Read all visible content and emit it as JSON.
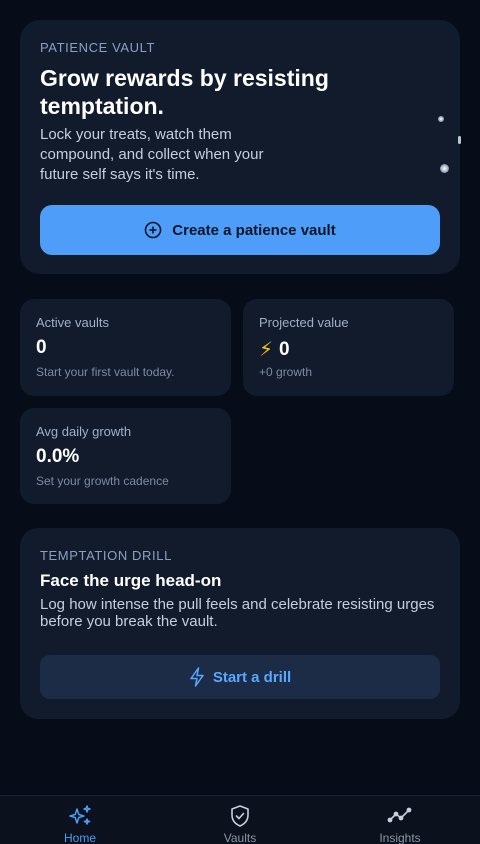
{
  "hero": {
    "eyebrow": "PATIENCE VAULT",
    "title": "Grow rewards by resisting temptation.",
    "subtitle": "Lock your treats, watch them compound, and collect when your future self says it's time.",
    "cta_label": "Create a patience vault",
    "cta_icon": "plus-circle-icon"
  },
  "stats": [
    {
      "label": "Active vaults",
      "value": "0",
      "note": "Start your first vault today."
    },
    {
      "label": "Projected value",
      "icon": "⚡",
      "value": "0",
      "note": "+0 growth"
    },
    {
      "label": "Avg daily growth",
      "value": "0.0%",
      "note": "Set your growth cadence"
    }
  ],
  "drill": {
    "eyebrow": "TEMPTATION DRILL",
    "title": "Face the urge head-on",
    "description": "Log how intense the pull feels and celebrate resisting urges before you break the vault.",
    "cta_label": "Start a drill",
    "cta_icon": "bolt-icon"
  },
  "tabs": [
    {
      "label": "Home",
      "icon": "sparkles-icon",
      "active": true
    },
    {
      "label": "Vaults",
      "icon": "shield-check-icon",
      "active": false
    },
    {
      "label": "Insights",
      "icon": "trend-line-icon",
      "active": false
    }
  ],
  "colors": {
    "background": "#060c18",
    "card": "#121b2c",
    "accent": "#4d9df9",
    "secondary_button": "#1c2c47"
  }
}
